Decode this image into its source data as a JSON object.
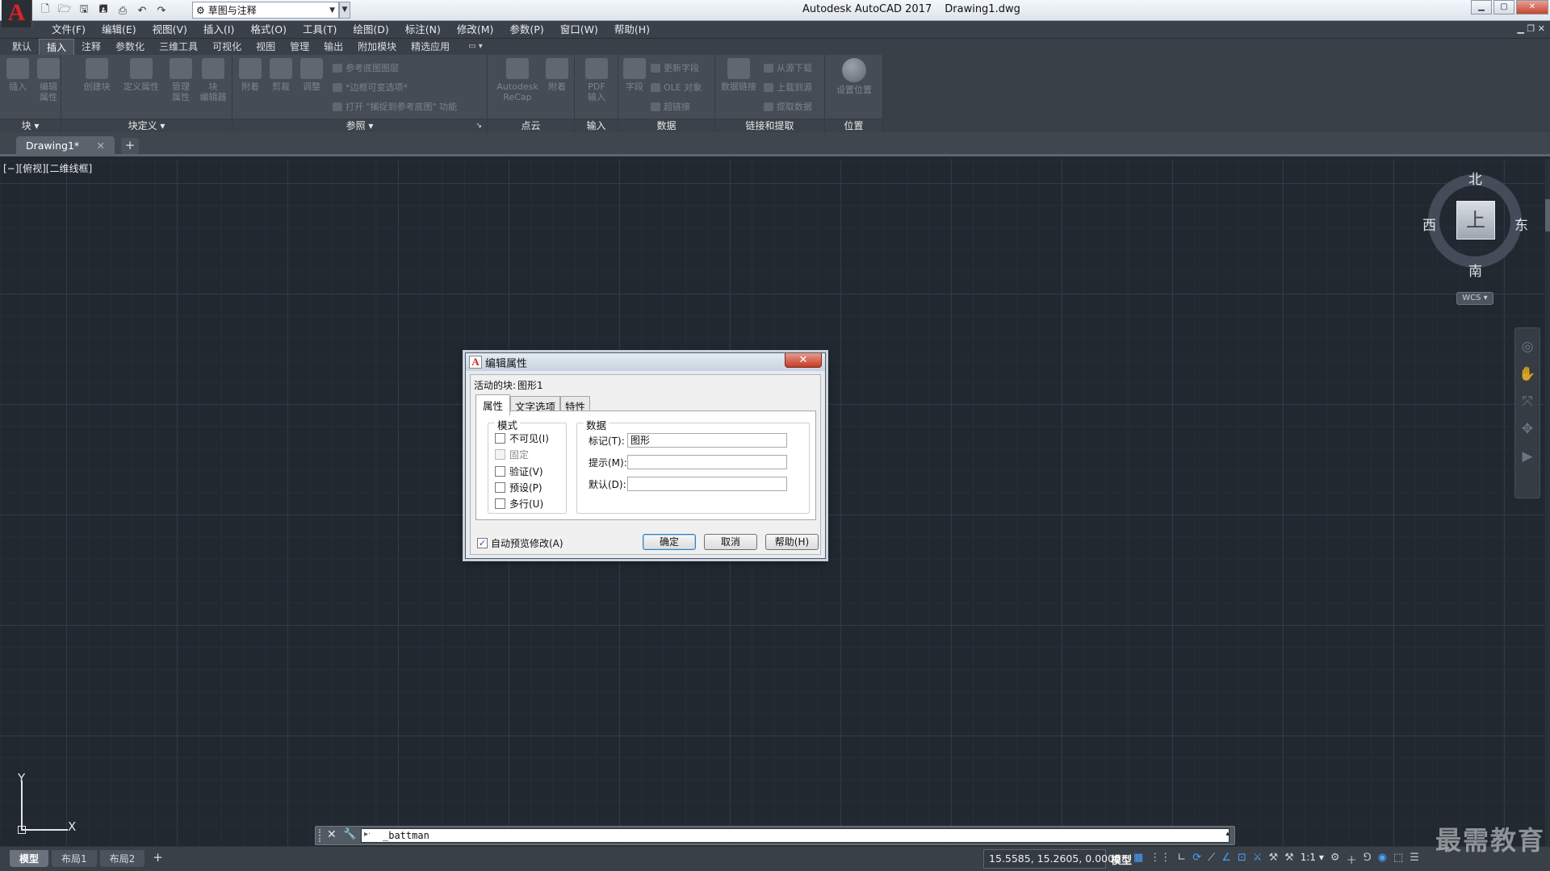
{
  "titlebar": {
    "app_letter": "A",
    "app_name": "Autodesk AutoCAD 2017",
    "file_name": "Drawing1.dwg",
    "workspace": "草图与注释",
    "qat_icons": [
      "new-icon",
      "open-icon",
      "save-icon",
      "saveas-icon",
      "print-icon",
      "undo-icon",
      "redo-icon"
    ],
    "win_min": "▁",
    "win_max": "▢",
    "win_close": "✕"
  },
  "menubar": {
    "items": [
      "文件(F)",
      "编辑(E)",
      "视图(V)",
      "插入(I)",
      "格式(O)",
      "工具(T)",
      "绘图(D)",
      "标注(N)",
      "修改(M)",
      "参数(P)",
      "窗口(W)",
      "帮助(H)"
    ],
    "doc_controls": "▁  ❐  ✕"
  },
  "ribbon": {
    "tabs": [
      "默认",
      "插入",
      "注释",
      "参数化",
      "三维工具",
      "可视化",
      "视图",
      "管理",
      "输出",
      "附加模块",
      "精选应用"
    ],
    "active_tab": "插入",
    "tab_more": "▭ ▾",
    "panels": {
      "block": {
        "title": "块 ▾",
        "buttons": [
          "插入",
          "编辑\n属性"
        ]
      },
      "block_def": {
        "title": "块定义 ▾",
        "buttons": [
          "创建块",
          "定义属性",
          "管理\n属性",
          "块\n编辑器"
        ]
      },
      "reference": {
        "title": "参照 ▾",
        "buttons": [
          "附着",
          "剪裁",
          "调整"
        ],
        "small": [
          "参考底图图层",
          "*边框可变选项*",
          "打开 \"捕捉到参考底图\" 功能"
        ],
        "corner": "↘"
      },
      "pointcloud": {
        "title": "点云",
        "buttons": [
          "Autodesk\nReCap",
          "附着"
        ]
      },
      "import": {
        "title": "输入",
        "buttons": [
          "PDF\n输入"
        ]
      },
      "data": {
        "title": "数据",
        "buttons": [
          "字段"
        ],
        "small": [
          "更新字段",
          "OLE 对象",
          "超链接"
        ]
      },
      "linking": {
        "title": "链接和提取",
        "buttons": [
          "数据链接"
        ],
        "small": [
          "从源下载",
          "上载到源",
          "提取数据"
        ]
      },
      "location": {
        "title": "位置",
        "buttons": [
          "设置位置"
        ]
      }
    }
  },
  "filetabs": {
    "doc": "Drawing1*",
    "close": "✕",
    "add": "+"
  },
  "viewport": {
    "label": "[−][俯视][二维线框]"
  },
  "viewcube": {
    "north": "北",
    "south": "南",
    "east": "东",
    "west": "西",
    "face": "上",
    "wcs": "WCS ▾"
  },
  "navbar": {
    "icons": [
      "steeringwheel-icon",
      "pan-icon",
      "zoom-icon",
      "orbit-icon",
      "showmotion-icon"
    ]
  },
  "ucs": {
    "x": "X",
    "y": "Y"
  },
  "command": {
    "close": "✕",
    "tool": "🔧",
    "prompt": "▸·",
    "text": "_battman",
    "history": "▴"
  },
  "layouts": {
    "tabs": [
      "模型",
      "布局1",
      "布局2"
    ],
    "active": "模型",
    "add": "+"
  },
  "status": {
    "coords": "15.5585, 15.2605, 0.0000",
    "model": "模型",
    "scale": "1:1 ▾",
    "icons": [
      "grid-icon",
      "snap-icon",
      "ortho-icon",
      "polar-icon",
      "osnap-icon",
      "otrack-icon",
      "lineweight-icon",
      "transparency-icon",
      "selection-cycling-icon",
      "annotation-visibility-icon",
      "autoscale-icon",
      "scale-icon",
      "workspace-icon",
      "plus-icon",
      "units-icon",
      "isolate-icon",
      "hardware-icon",
      "clean-screen-icon",
      "customize-icon"
    ]
  },
  "watermark": "最需教育",
  "dialog": {
    "title": "编辑属性",
    "icon_letter": "A",
    "close": "✕",
    "active_block_label": "活动的块:",
    "active_block_value": "图形1",
    "tabs": [
      "属性",
      "文字选项",
      "特性"
    ],
    "active_tab": "属性",
    "mode": {
      "title": "模式",
      "options": [
        {
          "label": "不可见(I)",
          "checked": false,
          "enabled": true
        },
        {
          "label": "固定",
          "checked": false,
          "enabled": false
        },
        {
          "label": "验证(V)",
          "checked": false,
          "enabled": true
        },
        {
          "label": "预设(P)",
          "checked": false,
          "enabled": true
        },
        {
          "label": "多行(U)",
          "checked": false,
          "enabled": true
        }
      ]
    },
    "data": {
      "title": "数据",
      "tag_label": "标记(T):",
      "tag_value": "图形",
      "prompt_label": "提示(M):",
      "prompt_value": "",
      "default_label": "默认(D):",
      "default_value": ""
    },
    "auto_preview": {
      "label": "自动预览修改(A)",
      "checked": true,
      "mark": "✓"
    },
    "buttons": {
      "ok": "确定",
      "cancel": "取消",
      "help": "帮助(H)"
    }
  }
}
